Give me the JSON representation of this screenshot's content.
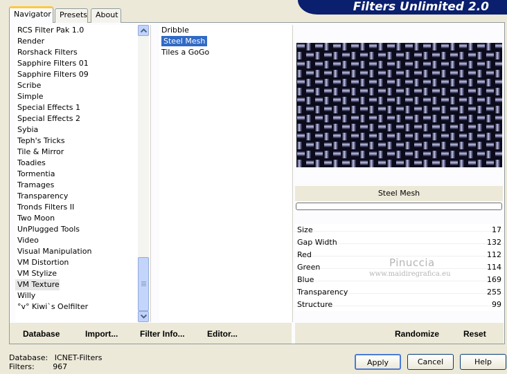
{
  "banner": {
    "title": "Filters Unlimited 2.0"
  },
  "tabs": [
    {
      "label": "Navigator",
      "active": true
    },
    {
      "label": "Presets",
      "active": false
    },
    {
      "label": "About",
      "active": false
    }
  ],
  "categories": {
    "items": [
      "RCS Filter Pak 1.0",
      "Render",
      "Rorshack Filters",
      "Sapphire Filters 01",
      "Sapphire Filters 09",
      "Scribe",
      "Simple",
      "Special Effects 1",
      "Special Effects 2",
      "Sybia",
      "Teph's Tricks",
      "Tile & Mirror",
      "Toadies",
      "Tormentia",
      "Tramages",
      "Transparency",
      "Tronds Filters II",
      "Two Moon",
      "UnPlugged Tools",
      "Video",
      "Visual Manipulation",
      "VM Distortion",
      "VM Stylize",
      "VM Texture",
      "Willy",
      "°v° Kiwi`s Oelfilter"
    ],
    "selected": "VM Texture"
  },
  "filters": {
    "items": [
      "Dribble",
      "Steel Mesh",
      "Tiles a GoGo"
    ],
    "selected": "Steel Mesh"
  },
  "link_buttons": {
    "database": "Database",
    "import": "Import...",
    "filter_info": "Filter Info...",
    "editor": "Editor...",
    "randomize": "Randomize",
    "reset": "Reset"
  },
  "preview": {
    "filter_name": "Steel Mesh",
    "colors": {
      "dark": "#0b0b1c",
      "light": "#b8bad9",
      "mid": "#5d5f95"
    }
  },
  "parameters": [
    {
      "name": "Size",
      "value": "17"
    },
    {
      "name": "Gap Width",
      "value": "132"
    },
    {
      "name": "Red",
      "value": "112"
    },
    {
      "name": "Green",
      "value": "114"
    },
    {
      "name": "Blue",
      "value": "169"
    },
    {
      "name": "Transparency",
      "value": "255"
    },
    {
      "name": "Structure",
      "value": "99"
    }
  ],
  "watermark": {
    "line1": "Pinuccia",
    "line2": "www.maidiregrafica.eu"
  },
  "status": {
    "database_label": "Database:",
    "database_value": "ICNET-Filters",
    "filters_label": "Filters:",
    "filters_value": "967"
  },
  "dialog_buttons": {
    "apply": "Apply",
    "cancel": "Cancel",
    "help": "Help"
  },
  "accent_colors": {
    "selection": "#316ac5",
    "banner": "#0a1f6e",
    "tab_highlight": "#ffc83c"
  }
}
